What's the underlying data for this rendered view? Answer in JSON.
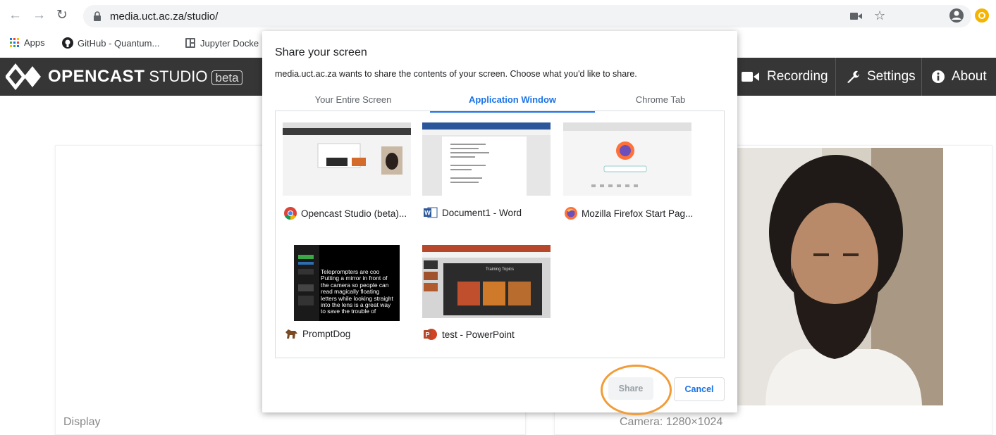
{
  "browser": {
    "url": "media.uct.ac.za/studio/",
    "bookmarks": [
      {
        "label": "Apps",
        "icon": "apps-grid-icon"
      },
      {
        "label": "GitHub - Quantum...",
        "icon": "github-icon"
      },
      {
        "label": "Jupyter Docke",
        "icon": "jupyter-icon"
      }
    ]
  },
  "header": {
    "brand": "OPENCAST",
    "product": "STUDIO",
    "badge": "beta",
    "nav": [
      {
        "label": "Recording",
        "icon": "video-camera-icon"
      },
      {
        "label": "Settings",
        "icon": "wrench-icon"
      },
      {
        "label": "About",
        "icon": "info-icon"
      }
    ]
  },
  "page": {
    "display_label": "Display",
    "camera_label": "Camera: 1280×1024"
  },
  "dialog": {
    "title": "Share your screen",
    "description": "media.uct.ac.za wants to share the contents of your screen. Choose what you'd like to share.",
    "tabs": [
      {
        "label": "Your Entire Screen",
        "active": false
      },
      {
        "label": "Application Window",
        "active": true
      },
      {
        "label": "Chrome Tab",
        "active": false
      }
    ],
    "windows": [
      {
        "label": "Opencast Studio (beta)...",
        "icon": "chrome-icon"
      },
      {
        "label": "Document1 - Word",
        "icon": "word-icon"
      },
      {
        "label": "Mozilla Firefox Start Pag...",
        "icon": "firefox-icon"
      },
      {
        "label": "PromptDog",
        "icon": "promptdog-icon"
      },
      {
        "label": "test - PowerPoint",
        "icon": "powerpoint-icon"
      }
    ],
    "thumb_text": {
      "promptdog": "Teleprompters are coo Putting a mirror in front of the camera so people can read magically floating letters while looking straight into the lens is a great way to save the trouble of",
      "ppt": "Training Topics"
    },
    "share_label": "Share",
    "cancel_label": "Cancel"
  },
  "colors": {
    "header_bg": "#363636",
    "accent": "#1a73e8",
    "highlight": "#f29c38"
  }
}
